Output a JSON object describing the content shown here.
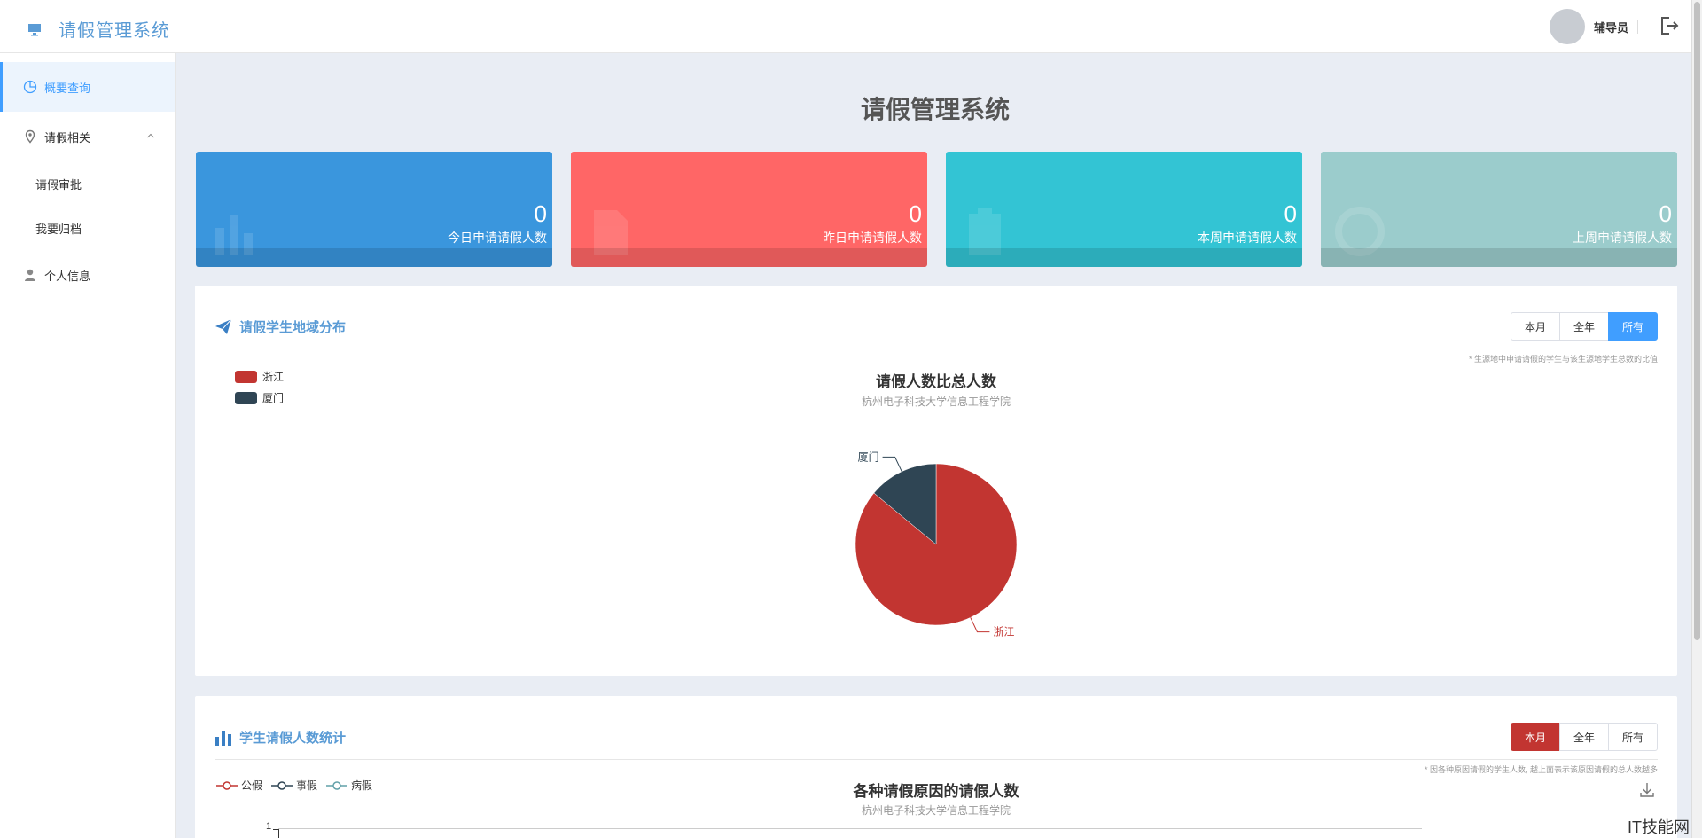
{
  "header": {
    "brand_icon": "monitor-icon",
    "app_title": "请假管理系统",
    "user_name": "辅导员",
    "logout_icon": "logout-icon"
  },
  "sidebar": {
    "items": [
      {
        "label": "概要查询",
        "icon": "pie-chart-icon",
        "active": true
      },
      {
        "label": "请假相关",
        "icon": "location-icon",
        "expanded": true
      },
      {
        "label": "请假审批",
        "sub": true
      },
      {
        "label": "我要归档",
        "sub": true
      },
      {
        "label": "个人信息",
        "icon": "person-icon"
      }
    ]
  },
  "main": {
    "title": "请假管理系统",
    "stats": [
      {
        "value": "0",
        "label": "今日申请请假人数",
        "color": "#3a96dd",
        "icon": "bar-chart-icon"
      },
      {
        "value": "0",
        "label": "昨日申请请假人数",
        "color": "#ff6666",
        "icon": "document-icon"
      },
      {
        "value": "0",
        "label": "本周申请请假人数",
        "color": "#33c4d4",
        "icon": "clipboard-icon"
      },
      {
        "value": "0",
        "label": "上周申请请假人数",
        "color": "#9bcccc",
        "icon": "edge-icon"
      }
    ]
  },
  "region_panel": {
    "title": "请假学生地域分布",
    "icon": "paper-plane-icon",
    "buttons": [
      "本月",
      "全年",
      "所有"
    ],
    "active_button": "所有",
    "note": "* 生源地中申请请假的学生与该生源地学生总数的比值",
    "chart_title": "请假人数比总人数",
    "chart_subtitle": "杭州电子科技大学信息工程学院",
    "legend": [
      {
        "name": "浙江",
        "color": "#c23531"
      },
      {
        "name": "厦门",
        "color": "#2f4554"
      }
    ]
  },
  "stats_panel": {
    "title": "学生请假人数统计",
    "icon": "bar-chart-icon",
    "buttons": [
      "本月",
      "全年",
      "所有"
    ],
    "active_button": "本月",
    "note": "* 因各种原因请假的学生人数, 越上面表示该原因请假的总人数越多",
    "chart_title": "各种请假原因的请假人数",
    "chart_subtitle": "杭州电子科技大学信息工程学院",
    "download_icon": "download-icon",
    "legend": [
      {
        "name": "公假",
        "color": "#c23531"
      },
      {
        "name": "事假",
        "color": "#2f4554"
      },
      {
        "name": "病假",
        "color": "#61a0a8"
      }
    ],
    "y_tick_top": "1"
  },
  "chart_data": [
    {
      "type": "pie",
      "title": "请假人数比总人数",
      "subtitle": "杭州电子科技大学信息工程学院",
      "legend_position": "top-left",
      "slices": [
        {
          "name": "浙江",
          "value": 86,
          "color": "#c23531"
        },
        {
          "name": "厦门",
          "value": 14,
          "color": "#2f4554"
        }
      ]
    },
    {
      "type": "line",
      "title": "各种请假原因的请假人数",
      "subtitle": "杭州电子科技大学信息工程学院",
      "legend_position": "top-left",
      "series": [
        {
          "name": "公假",
          "values": []
        },
        {
          "name": "事假",
          "values": []
        },
        {
          "name": "病假",
          "values": []
        }
      ],
      "y_ticks_visible": [
        "1"
      ]
    }
  ],
  "watermark": "IT技能网"
}
